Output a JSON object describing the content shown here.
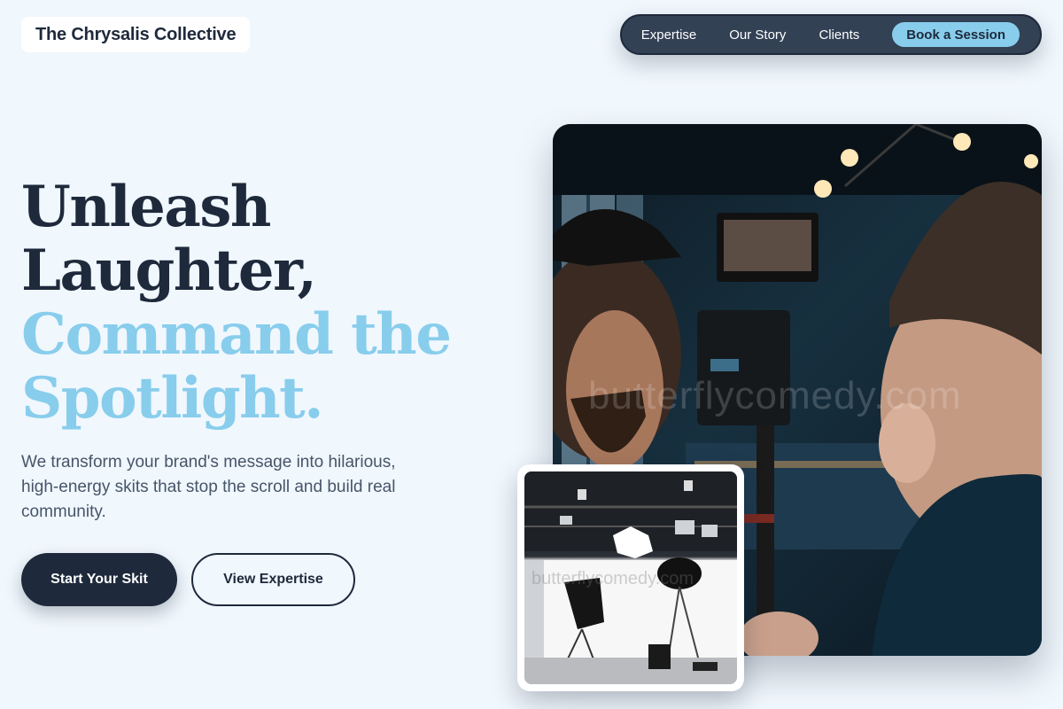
{
  "brand": {
    "name": "The Chrysalis Collective"
  },
  "nav": {
    "links": [
      "Expertise",
      "Our Story",
      "Clients"
    ],
    "cta_label": "Book a Session"
  },
  "hero": {
    "headline_dark": [
      "Unleash",
      "Laughter,"
    ],
    "headline_accent": [
      "Command the",
      "Spotlight."
    ],
    "subtext": "We transform your brand's message into hilarious, high-energy skits that stop the scroll and build real community.",
    "primary_button": "Start Your Skit",
    "secondary_button": "View Expertise"
  },
  "images": {
    "main_photo_watermark": "butterflycomedy.com",
    "inset_photo_watermark": "butterflycomedy.com",
    "main_photo_icon": "film-crew-camera-photo",
    "inset_photo_icon": "photo-studio-lighting-photo"
  },
  "colors": {
    "background": "#f0f7fd",
    "dark": "#1e293b",
    "accent": "#88cdec",
    "nav_bg": "#334155",
    "body_text": "#475569"
  }
}
